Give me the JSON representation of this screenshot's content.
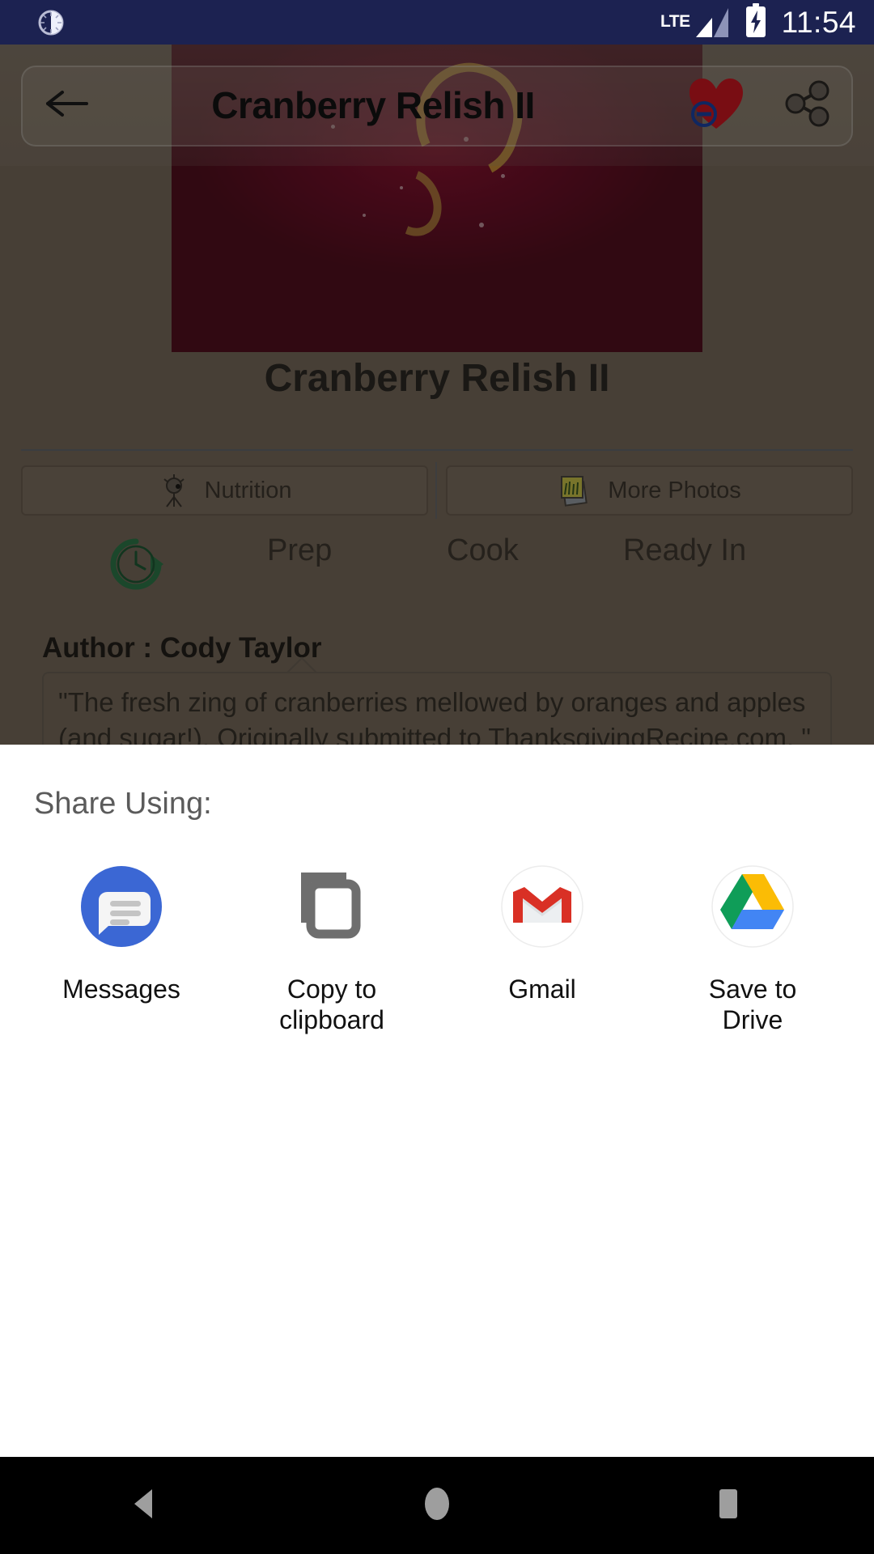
{
  "status_bar": {
    "left_icon": "clock-app-icon",
    "network_type": "LTE",
    "signal_icon": "signal-bars-icon",
    "battery_icon": "battery-charging-icon",
    "time": "11:54",
    "background_color": "#1c2251",
    "text_color": "#ffffff"
  },
  "app_bar": {
    "back_icon": "back-arrow-icon",
    "title": "Cranberry Relish II",
    "favorite_icon": "heart-filled-icon",
    "favorite_badge_icon": "remove-circle-badge-icon",
    "share_icon": "share-nodes-icon",
    "heart_color": "#d01722",
    "badge_color": "#1a44a8"
  },
  "recipe": {
    "hero_image_alt": "bowl-of-cranberry-relish-photo",
    "title": "Cranberry Relish II",
    "buttons": [
      {
        "label": "Nutrition",
        "icon": "nutrition-icon"
      },
      {
        "label": "More Photos",
        "icon": "photos-stack-icon"
      }
    ],
    "times": {
      "clock_icon": "clock-rotate-icon",
      "clock_color": "#2f7a4a",
      "labels": [
        "Prep",
        "Cook",
        "Ready In"
      ]
    },
    "author": "Author : Cody Taylor",
    "description": "\"The fresh zing of cranberries mellowed by oranges and apples (and sugar!). Originally submitted to ThanksgivingRecipe.com. \""
  },
  "share_sheet": {
    "title": "Share Using:",
    "background_color": "#ffffff",
    "targets": [
      {
        "label": "Messages",
        "icon": "google-messages-icon",
        "color": "#3b67d4"
      },
      {
        "label": "Copy to clipboard",
        "icon": "copy-clipboard-icon",
        "color": "#6e6e6e"
      },
      {
        "label": "Gmail",
        "icon": "gmail-icon",
        "color": "#d93025"
      },
      {
        "label": "Save to Drive",
        "icon": "google-drive-icon",
        "color": "#0f9d58"
      }
    ]
  },
  "nav_bar": {
    "background_color": "#000000",
    "keys": [
      {
        "name": "back",
        "icon": "nav-back-triangle-icon"
      },
      {
        "name": "home",
        "icon": "nav-home-circle-icon"
      },
      {
        "name": "recents",
        "icon": "nav-recents-square-icon"
      }
    ]
  }
}
